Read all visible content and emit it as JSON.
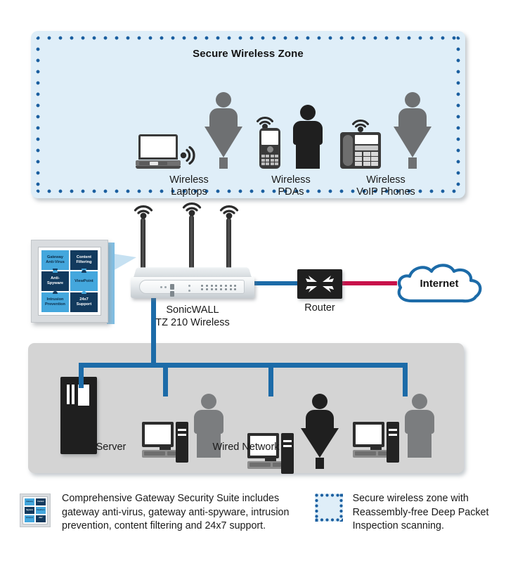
{
  "wireless_zone": {
    "title": "Secure Wireless Zone",
    "devices": [
      {
        "icon": "laptop-icon",
        "label_line1": "Wireless",
        "label_line2": "Laptops"
      },
      {
        "icon": "pda-icon",
        "label_line1": "Wireless",
        "label_line2": "PDAs"
      },
      {
        "icon": "voip-phone-icon",
        "label_line1": "Wireless",
        "label_line2": "VoIP Phones"
      }
    ]
  },
  "appliance": {
    "name_line1": "SonicWALL",
    "name_line2": "TZ 210 Wireless",
    "antenna_count": 3
  },
  "security_suite": {
    "pieces": [
      {
        "line1": "Gateway",
        "line2": "Anti-Virus",
        "tone": "light"
      },
      {
        "line1": "Content",
        "line2": "Filtering",
        "tone": "dark"
      },
      {
        "line1": "Anti-",
        "line2": "Spyware",
        "tone": "dark"
      },
      {
        "line1": "ViewPoint",
        "line2": "",
        "tone": "light"
      },
      {
        "line1": "Intrusion",
        "line2": "Prevention",
        "tone": "light"
      },
      {
        "line1": "24x7",
        "line2": "Support",
        "tone": "dark"
      }
    ]
  },
  "router": {
    "label": "Router"
  },
  "internet": {
    "label": "Internet"
  },
  "wired_zone": {
    "server_label": "Server",
    "title": "Wired Network",
    "workstations": [
      {
        "person": "male"
      },
      {
        "person": "female"
      },
      {
        "person": "male"
      }
    ]
  },
  "legend": {
    "suite_entry": "Comprehensive Gateway Security Suite includes gateway anti-virus, gateway anti-spyware, intrusion prevention, content filtering and 24x7 support.",
    "zone_entry": "Secure wireless zone with Reassembly-free Deep Packet Inspection scanning."
  },
  "colors": {
    "link_blue": "#1c6ba8",
    "wan_red": "#c8104a",
    "zone_fill": "#dfeef8",
    "zone_dot": "#1b5fa0",
    "wired_fill": "#d4d4d4",
    "suite_light": "#44a7dd",
    "suite_dark": "#123a5e"
  }
}
